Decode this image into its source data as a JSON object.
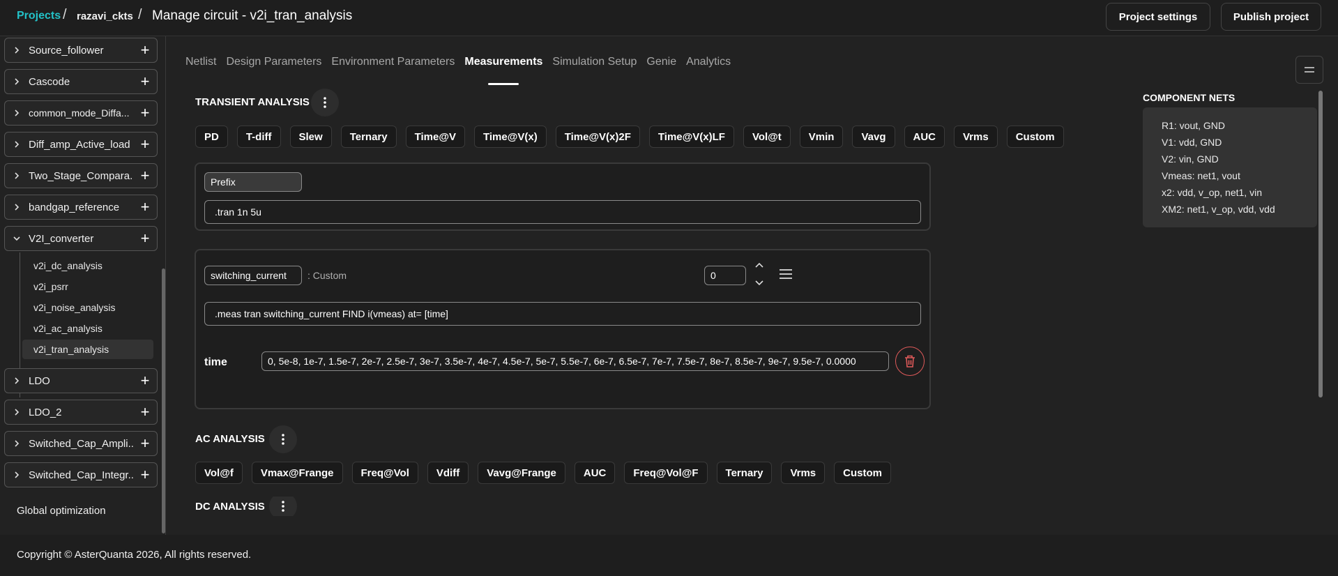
{
  "header": {
    "breadcrumb_projects": "Projects",
    "separator": "/",
    "project_name": "razavi_ckts",
    "page_title": "Manage circuit - v2i_tran_analysis",
    "project_settings_label": "Project settings",
    "publish_label": "Publish project"
  },
  "sidebar": {
    "items_top": [
      {
        "label": "Source_follower"
      },
      {
        "label": "Cascode"
      },
      {
        "label": "common_mode_Diffa..."
      },
      {
        "label": "Diff_amp_Active_load"
      },
      {
        "label": "Two_Stage_Compara..."
      },
      {
        "label": "bandgap_reference"
      },
      {
        "label": "V2I_converter"
      }
    ],
    "children": [
      {
        "label": "v2i_dc_analysis"
      },
      {
        "label": "v2i_psrr"
      },
      {
        "label": "v2i_noise_analysis"
      },
      {
        "label": "v2i_ac_analysis"
      },
      {
        "label": "v2i_tran_analysis"
      }
    ],
    "items_bottom": [
      {
        "label": "LDO"
      },
      {
        "label": "LDO_2"
      },
      {
        "label": "Switched_Cap_Ampli..."
      },
      {
        "label": "Switched_Cap_Integr..."
      }
    ],
    "global_optimization": "Global optimization"
  },
  "tabs": [
    {
      "label": "Netlist"
    },
    {
      "label": "Design Parameters"
    },
    {
      "label": "Environment Parameters"
    },
    {
      "label": "Measurements"
    },
    {
      "label": "Simulation Setup"
    },
    {
      "label": "Genie"
    },
    {
      "label": "Analytics"
    }
  ],
  "transient": {
    "title": "TRANSIENT ANALYSIS",
    "chips": [
      "PD",
      "T-diff",
      "Slew",
      "Ternary",
      "Time@V",
      "Time@V(x)",
      "Time@V(x)2F",
      "Time@V(x)LF",
      "Vol@t",
      "Vmin",
      "Vavg",
      "AUC",
      "Vrms",
      "Custom"
    ],
    "prefix_label": "Prefix",
    "prefix_value": ".tran 1n 5u",
    "measure_name": "switching_current",
    "measure_type": ": Custom",
    "order_value": "0",
    "measure_expr": ".meas tran switching_current FIND i(vmeas) at= [time]",
    "time_label": "time",
    "time_values": "0, 5e-8, 1e-7, 1.5e-7, 2e-7, 2.5e-7, 3e-7, 3.5e-7, 4e-7, 4.5e-7, 5e-7, 5.5e-7, 6e-7, 6.5e-7, 7e-7, 7.5e-7, 8e-7, 8.5e-7, 9e-7, 9.5e-7, 0.0000"
  },
  "ac": {
    "title": "AC ANALYSIS",
    "chips": [
      "Vol@f",
      "Vmax@Frange",
      "Freq@Vol",
      "Vdiff",
      "Vavg@Frange",
      "AUC",
      "Freq@Vol@F",
      "Ternary",
      "Vrms",
      "Custom"
    ]
  },
  "dc": {
    "title": "DC ANALYSIS"
  },
  "component_nets": {
    "title": "COMPONENT NETS",
    "lines": [
      "R1: vout, GND",
      "V1: vdd, GND",
      "V2: vin, GND",
      "Vmeas: net1, vout",
      "x2: vdd, v_op, net1, vin",
      "XM2: net1, v_op, vdd, vdd"
    ]
  },
  "footer": {
    "copyright": "Copyright © AsterQuanta 2026, All rights reserved."
  },
  "colors": {
    "accent": "#23c2c8",
    "danger": "#e05a5a"
  }
}
